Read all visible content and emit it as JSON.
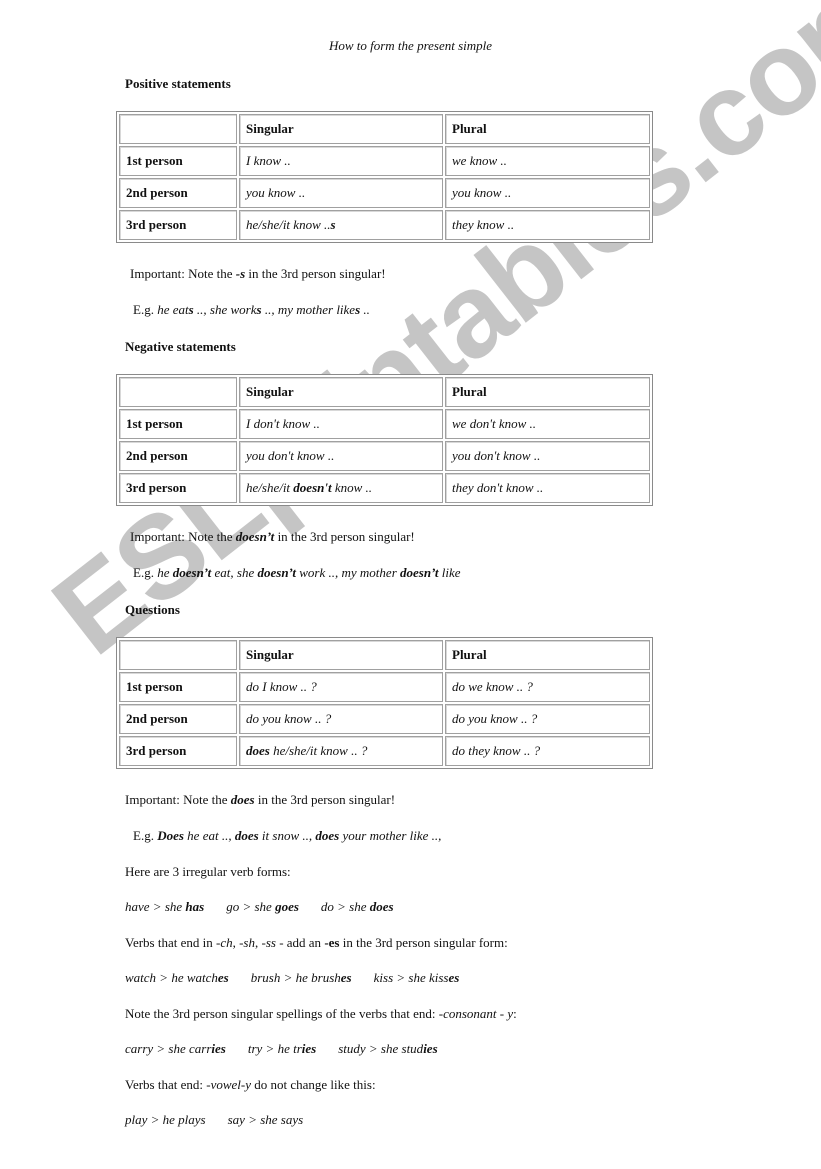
{
  "title": "How to form the present simple",
  "watermark": "ESLprintables.com",
  "sections": [
    {
      "heading": "Positive statements",
      "table": {
        "headers": [
          "",
          "Singular",
          "Plural"
        ],
        "rows": [
          {
            "person": "1st person",
            "singular": [
              "I know .."
            ],
            "plural": "we know .."
          },
          {
            "person": "2nd person",
            "singular": [
              "you know .."
            ],
            "plural": "you know .."
          },
          {
            "person": "3rd person",
            "singular": [
              "he/she/it know ..",
              "s",
              ""
            ],
            "plural": "they know .."
          }
        ]
      },
      "important": {
        "prefix": "Important:  Note the ",
        "bold": "-s",
        "suffix": " in the 3rd person singular!"
      },
      "example": {
        "lead": "E.g. ",
        "parts": [
          {
            "text": "he eat",
            "b": false
          },
          {
            "text": "s",
            "b": true
          },
          {
            "text": " .., she work",
            "b": false
          },
          {
            "text": "s",
            "b": true
          },
          {
            "text": " .., my mother like",
            "b": false
          },
          {
            "text": "s",
            "b": true
          },
          {
            "text": " ..",
            "b": false
          }
        ]
      }
    },
    {
      "heading": "Negative statements",
      "table": {
        "headers": [
          "",
          "Singular",
          "Plural"
        ],
        "rows": [
          {
            "person": "1st person",
            "singular": [
              "I don't know .."
            ],
            "plural": "we don't know .."
          },
          {
            "person": "2nd person",
            "singular": [
              "you don't know .."
            ],
            "plural": "you don't know .."
          },
          {
            "person": "3rd person",
            "singular": [
              "he/she/it ",
              "doesn't",
              " know .."
            ],
            "plural": "they don't know .."
          }
        ]
      },
      "important": {
        "prefix": "Important:  Note the ",
        "bold": "doesn’t",
        "suffix": " in the 3rd person singular!"
      },
      "example": {
        "lead": "E.g. ",
        "parts": [
          {
            "text": "he ",
            "b": false
          },
          {
            "text": "doesn’t",
            "b": true
          },
          {
            "text": " eat, she ",
            "b": false
          },
          {
            "text": "doesn’t",
            "b": true
          },
          {
            "text": "  work .., my mother ",
            "b": false
          },
          {
            "text": "doesn’t",
            "b": true
          },
          {
            "text": " like",
            "b": false
          }
        ]
      }
    },
    {
      "heading": "Questions",
      "table": {
        "headers": [
          "",
          "Singular",
          "Plural"
        ],
        "rows": [
          {
            "person": "1st person",
            "singular": [
              "do I know .. ?"
            ],
            "plural": "do we know .. ?"
          },
          {
            "person": "2nd person",
            "singular": [
              "do you know .. ?"
            ],
            "plural": "do you know .. ?"
          },
          {
            "person": "3rd person",
            "singular": [
              "",
              "does",
              " he/she/it know .. ?"
            ],
            "plural": "do they know .. ?"
          }
        ]
      },
      "important": {
        "prefix": "Important:  Note the ",
        "bold": "does",
        "suffix": " in the 3rd person singular!"
      },
      "example": {
        "lead": "E.g. ",
        "parts": [
          {
            "text": "Does",
            "b": true
          },
          {
            "text": " he eat ..,  ",
            "b": false
          },
          {
            "text": "does",
            "b": true
          },
          {
            "text": " it snow ..,  ",
            "b": false
          },
          {
            "text": "does",
            "b": true
          },
          {
            "text": " your mother like ..,",
            "b": false
          }
        ]
      }
    }
  ],
  "irregular": {
    "intro": "Here are 3 irregular verb forms:",
    "items": [
      {
        "base": "have > she ",
        "form": "has"
      },
      {
        "base": "go > she ",
        "form": "goes"
      },
      {
        "base": "do > she ",
        "form": "does"
      }
    ]
  },
  "es_rule": {
    "intro_parts": [
      {
        "text": "Verbs that end in ",
        "s": "n"
      },
      {
        "text": "-ch",
        "s": "i"
      },
      {
        "text": ", ",
        "s": "n"
      },
      {
        "text": "-sh",
        "s": "i"
      },
      {
        "text": ", ",
        "s": "n"
      },
      {
        "text": "-ss",
        "s": "i"
      },
      {
        "text": " - add an ",
        "s": "n"
      },
      {
        "text": "-es",
        "s": "b"
      },
      {
        "text": " in the 3rd person singular form:",
        "s": "n"
      }
    ],
    "items": [
      {
        "base": "watch > he watch",
        "form": "es"
      },
      {
        "base": "brush > he brush",
        "form": "es"
      },
      {
        "base": "kiss > she kiss",
        "form": "es"
      }
    ]
  },
  "y_rule": {
    "intro_parts": [
      {
        "text": "Note the 3rd person singular spellings of the verbs that end: ",
        "s": "n"
      },
      {
        "text": "-consonant - y",
        "s": "i"
      },
      {
        "text": ":",
        "s": "n"
      }
    ],
    "items": [
      {
        "base": "carry > she carr",
        "form": "ies"
      },
      {
        "base": "try > he tr",
        "form": "ies"
      },
      {
        "base": "study > she stud",
        "form": "ies"
      }
    ]
  },
  "vowel_y_rule": {
    "intro_parts": [
      {
        "text": "Verbs that end: ",
        "s": "n"
      },
      {
        "text": "-vowel-y",
        "s": "i"
      },
      {
        "text": " do not change like this:",
        "s": "n"
      }
    ],
    "items": [
      {
        "base": "play > he plays",
        "form": ""
      },
      {
        "base": "say > she says",
        "form": ""
      }
    ]
  }
}
